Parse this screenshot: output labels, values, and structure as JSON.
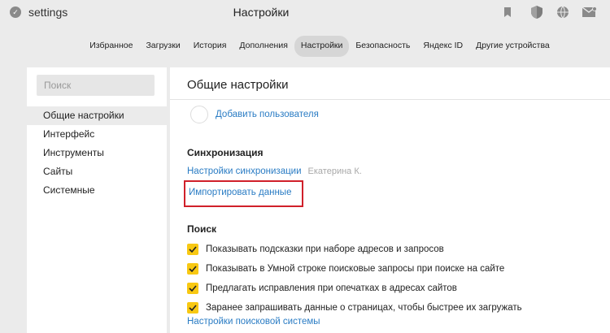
{
  "topbar": {
    "badge_glyph": "✓",
    "address": "settings",
    "title": "Настройки",
    "icons": [
      "bookmark-icon",
      "shield-icon",
      "globe-icon",
      "mail-icon"
    ]
  },
  "tabs": [
    {
      "label": "Избранное",
      "active": false
    },
    {
      "label": "Загрузки",
      "active": false
    },
    {
      "label": "История",
      "active": false
    },
    {
      "label": "Дополнения",
      "active": false
    },
    {
      "label": "Настройки",
      "active": true
    },
    {
      "label": "Безопасность",
      "active": false
    },
    {
      "label": "Яндекс ID",
      "active": false
    },
    {
      "label": "Другие устройства",
      "active": false
    }
  ],
  "sidebar": {
    "search_placeholder": "Поиск",
    "items": [
      {
        "label": "Общие настройки",
        "active": true
      },
      {
        "label": "Интерфейс",
        "active": false
      },
      {
        "label": "Инструменты",
        "active": false
      },
      {
        "label": "Сайты",
        "active": false
      },
      {
        "label": "Системные",
        "active": false
      }
    ]
  },
  "content": {
    "title": "Общие настройки",
    "add_user_link": "Добавить пользователя",
    "sync": {
      "heading": "Синхронизация",
      "settings_link": "Настройки синхронизации",
      "user_name": "Екатерина К.",
      "import_link": "Импортировать данные"
    },
    "search": {
      "heading": "Поиск",
      "options": [
        {
          "label": "Показывать подсказки при наборе адресов и запросов",
          "checked": true
        },
        {
          "label": "Показывать в Умной строке поисковые запросы при поиске на сайте",
          "checked": true
        },
        {
          "label": "Предлагать исправления при опечатках в адресах сайтов",
          "checked": true
        },
        {
          "label": "Заранее запрашивать данные о страницах, чтобы быстрее их загружать",
          "checked": true
        }
      ],
      "engine_link": "Настройки поисковой системы"
    }
  },
  "colors": {
    "link": "#2a7cc4",
    "checkbox": "#f8c812",
    "highlight_frame": "#d0202a",
    "active_tab": "#d6d6d6"
  }
}
